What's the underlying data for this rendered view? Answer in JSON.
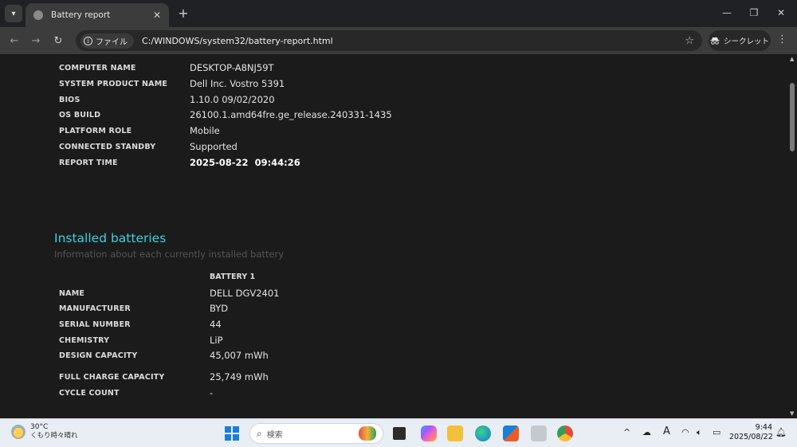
{
  "browser": {
    "tab_title": "Battery report",
    "tab_close": "✕",
    "new_tab": "+",
    "chip_label": "ファイル",
    "url": "C:/WINDOWS/system32/battery-report.html",
    "incognito_label": "シークレット"
  },
  "system": [
    {
      "key": "COMPUTER NAME",
      "value": "DESKTOP-A8NJ59T"
    },
    {
      "key": "SYSTEM PRODUCT NAME",
      "value": "Dell Inc. Vostro 5391"
    },
    {
      "key": "BIOS",
      "value": "1.10.0 09/02/2020"
    },
    {
      "key": "OS BUILD",
      "value": "26100.1.amd64fre.ge_release.240331-1435"
    },
    {
      "key": "PLATFORM ROLE",
      "value": "Mobile"
    },
    {
      "key": "CONNECTED STANDBY",
      "value": "Supported"
    },
    {
      "key": "REPORT TIME",
      "value": "2025-08-22  09:44:26"
    }
  ],
  "installed": {
    "title": "Installed batteries",
    "subtitle": "Information about each currently installed battery",
    "battery_header": "BATTERY 1",
    "rows": [
      {
        "key": "NAME",
        "value": "DELL DGV2401"
      },
      {
        "key": "MANUFACTURER",
        "value": "BYD"
      },
      {
        "key": "SERIAL NUMBER",
        "value": "44"
      },
      {
        "key": "CHEMISTRY",
        "value": "LiP"
      },
      {
        "key": "DESIGN CAPACITY",
        "value": "45,007 mWh"
      },
      {
        "key": "FULL CHARGE CAPACITY",
        "value": "25,749 mWh"
      },
      {
        "key": "CYCLE COUNT",
        "value": "-"
      }
    ]
  },
  "taskbar": {
    "temperature": "30°C",
    "weather_text": "くもり時々晴れ",
    "search_placeholder": "検索",
    "time": "9:44",
    "date": "2025/08/22",
    "ime_label": "A"
  }
}
